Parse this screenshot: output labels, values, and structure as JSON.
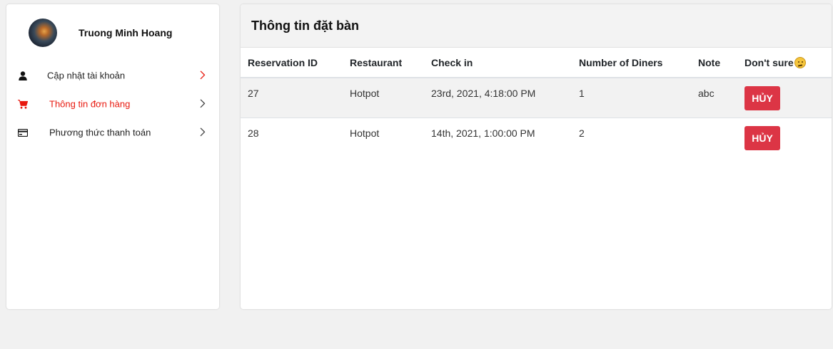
{
  "sidebar": {
    "user_name": "Truong Minh Hoang",
    "items": [
      {
        "label": "Cập nhật tài khoản",
        "icon": "person-icon"
      },
      {
        "label": "Thông tin đơn hàng",
        "icon": "cart-icon",
        "active": true
      },
      {
        "label": "Phương thức thanh toán",
        "icon": "credit-card-icon"
      }
    ]
  },
  "main": {
    "title": "Thông tin đặt bàn",
    "table": {
      "headers": [
        "Reservation ID",
        "Restaurant",
        "Check in",
        "Number of Diners",
        "Note",
        "Don't sure"
      ],
      "rows": [
        {
          "id": "27",
          "restaurant": "Hotpot",
          "check_in": "23rd, 2021, 4:18:00 PM",
          "diners": "1",
          "note": "abc",
          "action": "HỦY"
        },
        {
          "id": "28",
          "restaurant": "Hotpot",
          "check_in": "14th, 2021, 1:00:00 PM",
          "diners": "2",
          "note": "",
          "action": "HỦY"
        }
      ]
    }
  },
  "colors": {
    "accent_red": "#e8190f",
    "button_red": "#dc3545",
    "background": "#f1f1f1"
  }
}
